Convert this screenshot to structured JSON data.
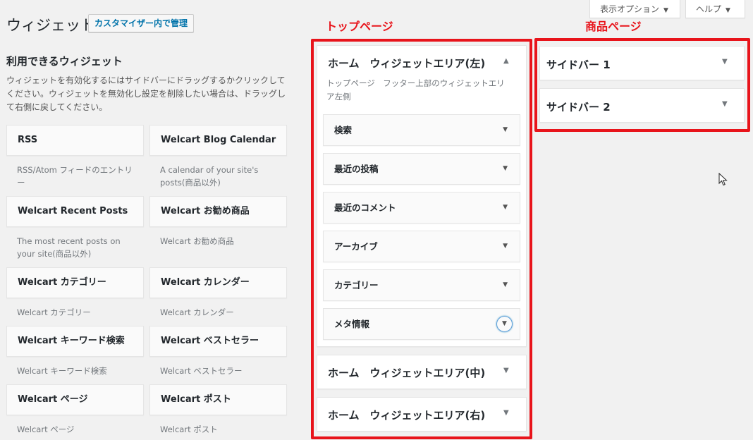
{
  "header": {
    "title": "ウィジェット",
    "customizer_button": "カスタマイザー内で管理",
    "screen_options": "表示オプション",
    "help": "ヘルプ"
  },
  "available": {
    "title": "利用できるウィジェット",
    "description": "ウィジェットを有効化するにはサイドバーにドラッグするかクリックしてください。ウィジェットを無効化し設定を削除したい場合は、ドラッグして右側に戻してください。",
    "widgets": [
      {
        "name": "RSS",
        "desc": "RSS/Atom フィードのエントリー"
      },
      {
        "name": "Welcart Blog Calendar",
        "desc": "A calendar of your site's posts(商品以外)"
      },
      {
        "name": "Welcart Recent Posts",
        "desc": "The most recent posts on your site(商品以外)"
      },
      {
        "name": "Welcart お勧め商品",
        "desc": "Welcart お勧め商品"
      },
      {
        "name": "Welcart カテゴリー",
        "desc": "Welcart カテゴリー"
      },
      {
        "name": "Welcart カレンダー",
        "desc": "Welcart カレンダー"
      },
      {
        "name": "Welcart キーワード検索",
        "desc": "Welcart キーワード検索"
      },
      {
        "name": "Welcart ベストセラー",
        "desc": "Welcart ベストセラー"
      },
      {
        "name": "Welcart ページ",
        "desc": "Welcart ページ"
      },
      {
        "name": "Welcart ポスト",
        "desc": "Welcart ポスト"
      }
    ]
  },
  "annotations": {
    "top_page": "トップページ",
    "product_page": "商品ページ"
  },
  "areas": {
    "home_left": {
      "title": "ホーム　ウィジェットエリア(左)",
      "description": "トップページ　フッター上部のウィジェットエリア左側",
      "widgets": [
        "検索",
        "最近の投稿",
        "最近のコメント",
        "アーカイブ",
        "カテゴリー",
        "メタ情報"
      ]
    },
    "home_center": {
      "title": "ホーム　ウィジェットエリア(中)"
    },
    "home_right": {
      "title": "ホーム　ウィジェットエリア(右)"
    },
    "sidebar1": {
      "title": "サイドバー 1"
    },
    "sidebar2": {
      "title": "サイドバー 2"
    }
  },
  "icons": {
    "arrow_down": "▼",
    "arrow_up": "▲"
  },
  "colors": {
    "annotation_red": "#e8141b",
    "link_blue": "#0073aa",
    "background": "#f1f1f1"
  }
}
